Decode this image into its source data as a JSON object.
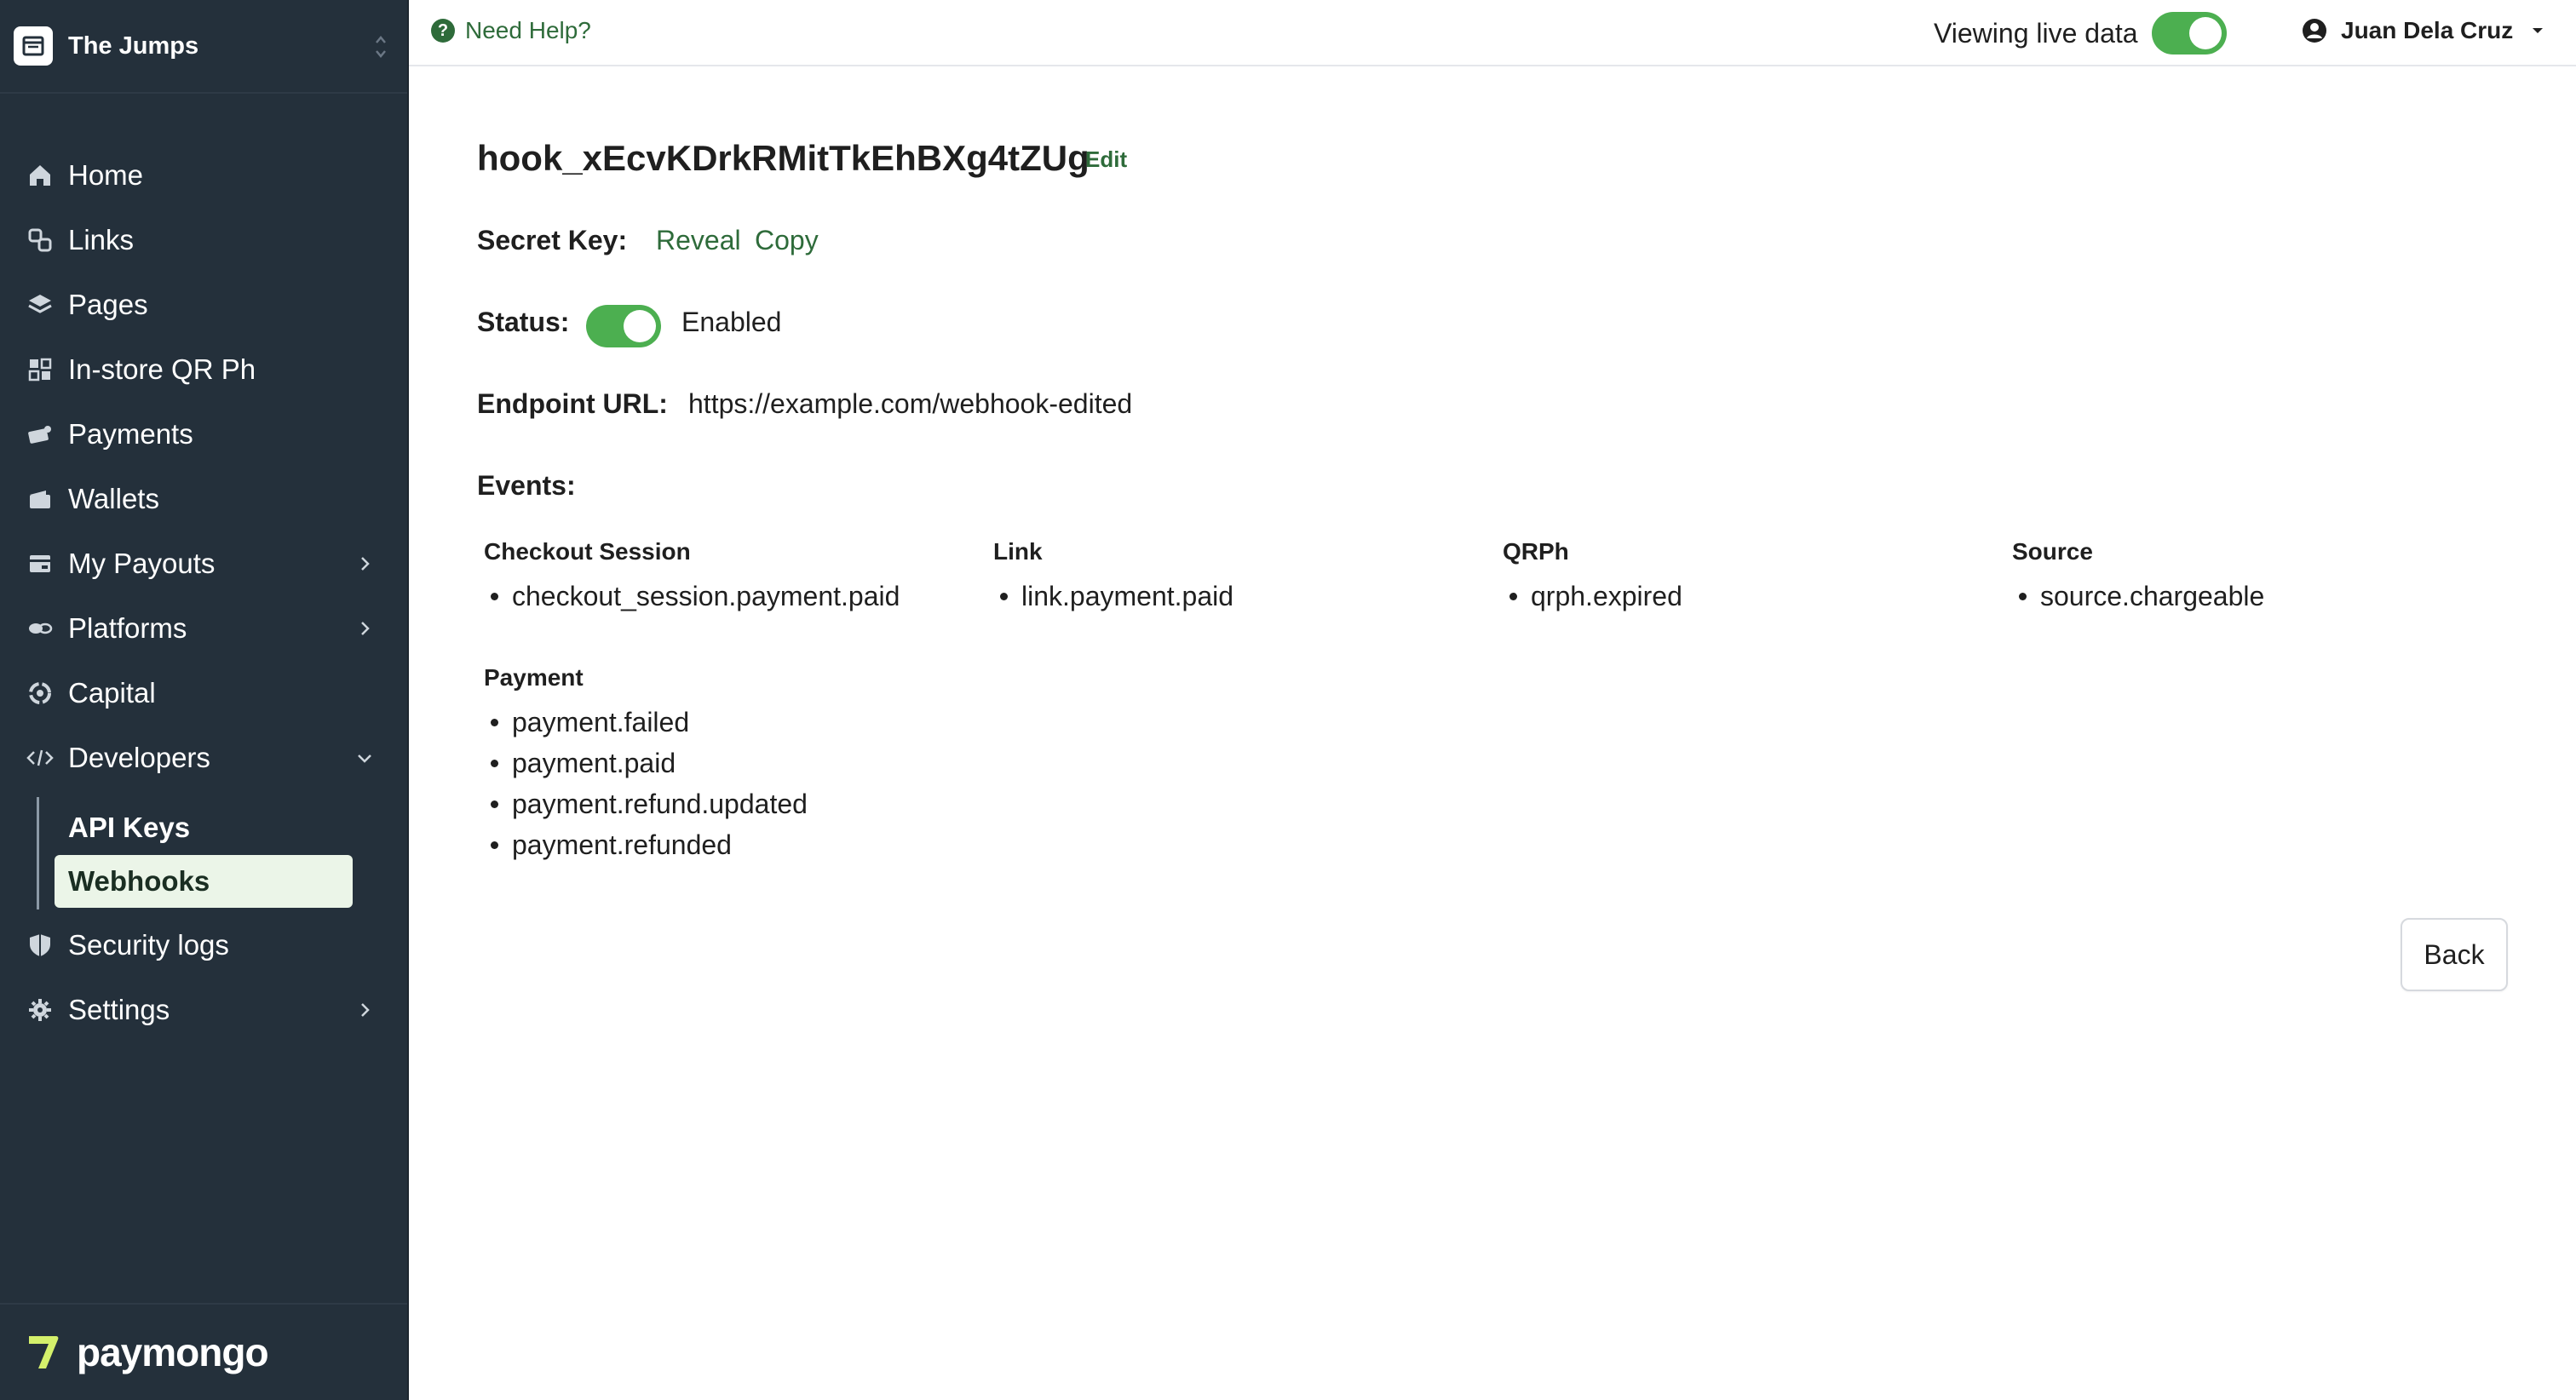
{
  "org": {
    "name": "The Jumps",
    "icon": "storefront-icon"
  },
  "nav": {
    "items": [
      {
        "label": "Home",
        "icon": "home-icon"
      },
      {
        "label": "Links",
        "icon": "link-icon"
      },
      {
        "label": "Pages",
        "icon": "layers-icon"
      },
      {
        "label": "In-store QR Ph",
        "icon": "qr-icon"
      },
      {
        "label": "Payments",
        "icon": "payments-icon"
      },
      {
        "label": "Wallets",
        "icon": "wallet-icon"
      },
      {
        "label": "My Payouts",
        "icon": "payouts-icon",
        "chevron": "right"
      },
      {
        "label": "Platforms",
        "icon": "platforms-icon",
        "chevron": "right"
      },
      {
        "label": "Capital",
        "icon": "capital-icon"
      },
      {
        "label": "Developers",
        "icon": "code-icon",
        "chevron": "down"
      }
    ],
    "developers_sub": [
      {
        "label": "API Keys",
        "active": false
      },
      {
        "label": "Webhooks",
        "active": true
      }
    ],
    "items_after": [
      {
        "label": "Security logs",
        "icon": "shield-icon"
      },
      {
        "label": "Settings",
        "icon": "gear-icon",
        "chevron": "right"
      }
    ]
  },
  "brand": {
    "name": "paymongo"
  },
  "topbar": {
    "help_label": "Need Help?",
    "live_label": "Viewing live data",
    "live_enabled": true,
    "user_name": "Juan Dela Cruz"
  },
  "webhook": {
    "id": "hook_xEcvKDrkRMitTkEhBXg4tZUg",
    "edit_label": "Edit",
    "secret_label": "Secret Key:",
    "reveal_label": "Reveal",
    "copy_label": "Copy",
    "status_label": "Status:",
    "status_value": "Enabled",
    "status_enabled": true,
    "endpoint_label": "Endpoint URL:",
    "endpoint_url": "https://example.com/webhook-edited",
    "events_label": "Events:",
    "event_groups": [
      {
        "title": "Checkout Session",
        "events": [
          "checkout_session.payment.paid"
        ]
      },
      {
        "title": "Link",
        "events": [
          "link.payment.paid"
        ]
      },
      {
        "title": "QRPh",
        "events": [
          "qrph.expired"
        ]
      },
      {
        "title": "Source",
        "events": [
          "source.chargeable"
        ]
      },
      {
        "title": "Payment",
        "events": [
          "payment.failed",
          "payment.paid",
          "payment.refund.updated",
          "payment.refunded"
        ]
      }
    ]
  },
  "actions": {
    "back_label": "Back"
  },
  "colors": {
    "sidebar_bg": "#24303b",
    "accent_green": "#2e6b3a",
    "toggle_green": "#4caf50",
    "active_item_bg": "#ebf5e8",
    "brand_mark": "#d4f06b"
  }
}
